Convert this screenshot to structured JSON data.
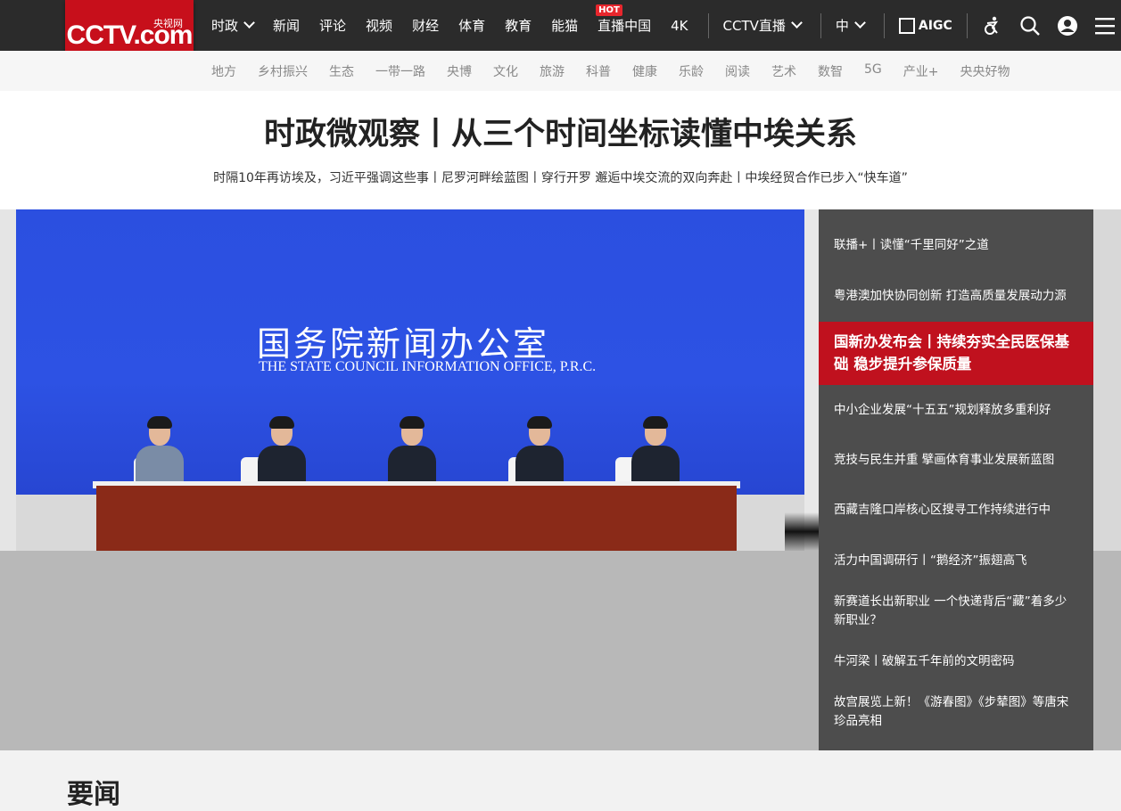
{
  "logo": {
    "main": "CCTV.com",
    "sub": "央视网"
  },
  "nav": {
    "items": [
      {
        "label": "时政",
        "chevron": true
      },
      {
        "label": "新闻"
      },
      {
        "label": "评论"
      },
      {
        "label": "视频"
      },
      {
        "label": "财经"
      },
      {
        "label": "体育"
      },
      {
        "label": "教育"
      },
      {
        "label": "能猫"
      },
      {
        "label": "直播中国",
        "badge": "HOT"
      },
      {
        "label": "4K"
      }
    ],
    "live": "CCTV直播",
    "lang": "中",
    "aigc": "AIGC"
  },
  "subnav": {
    "items": [
      "地方",
      "乡村振兴",
      "生态",
      "一带一路",
      "央博",
      "文化",
      "旅游",
      "科普",
      "健康",
      "乐龄",
      "阅读",
      "艺术",
      "数智",
      "5G",
      "产业+",
      "央央好物"
    ]
  },
  "headline": {
    "title": "时政微观察丨从三个时间坐标读懂中埃关系",
    "subline": "时隔10年再访埃及，习近平强调这些事丨尼罗河畔绘蓝图丨穿行开罗 邂逅中埃交流的双向奔赴丨中埃经贸合作已步入“快车道”"
  },
  "hero": {
    "wall_cn": "国务院新闻办公室",
    "wall_en": "THE STATE COUNCIL INFORMATION OFFICE, P.R.C."
  },
  "side_list": [
    "联播+丨读懂“千里同好”之道",
    "粤港澳加快协同创新 打造高质量发展动力源",
    "国新办发布会丨持续夯实全民医保基础 稳步提升参保质量",
    "中小企业发展“十五五”规划释放多重利好",
    "竞技与民生并重 擘画体育事业发展新蓝图",
    "西藏吉隆口岸核心区搜寻工作持续进行中",
    "活力中国调研行丨“鹅经济”振翅高飞",
    "新赛道长出新职业 一个快递背后“藏”着多少新职业？",
    "牛河梁丨破解五千年前的文明密码",
    "故宫展览上新！《游春图》《步辇图》等唐宋珍品亮相"
  ],
  "section": {
    "title": "要闻"
  },
  "colors": {
    "brand": "#c70f1b",
    "topbar": "#2b2b2b",
    "sidebar": "#4d4d4d",
    "active": "#c0111e"
  }
}
